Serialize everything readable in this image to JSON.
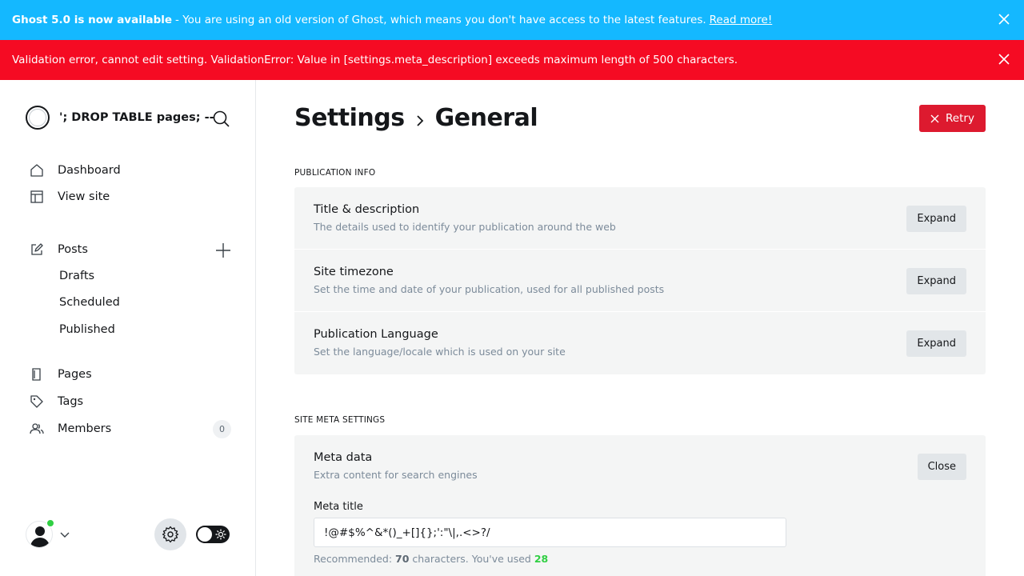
{
  "banners": {
    "upgrade": {
      "bold": "Ghost 5.0 is now available",
      "text": " - You are using an old version of Ghost, which means you don't have access to the latest features.",
      "link": "Read more!",
      "color": "#14b8ff"
    },
    "error": {
      "text": "Validation error, cannot edit setting. ValidationError: Value in [settings.meta_description] exceeds maximum length of 500 characters.",
      "color": "#f50b23"
    }
  },
  "sidebar": {
    "site_name": "'; DROP TABLE pages; --",
    "nav": {
      "dashboard": "Dashboard",
      "view_site": "View site",
      "posts": "Posts",
      "drafts": "Drafts",
      "scheduled": "Scheduled",
      "published": "Published",
      "pages": "Pages",
      "tags": "Tags",
      "members": "Members",
      "members_count": "0"
    }
  },
  "header": {
    "breadcrumb_root": "Settings",
    "breadcrumb_current": "General",
    "retry_label": "Retry"
  },
  "sections": {
    "publication_info": {
      "label": "Publication info",
      "rows": [
        {
          "title": "Title & description",
          "desc": "The details used to identify your publication around the web",
          "button": "Expand"
        },
        {
          "title": "Site timezone",
          "desc": "Set the time and date of your publication, used for all published posts",
          "button": "Expand"
        },
        {
          "title": "Publication Language",
          "desc": "Set the language/locale which is used on your site",
          "button": "Expand"
        }
      ]
    },
    "site_meta": {
      "label": "Site meta settings",
      "title": "Meta data",
      "desc": "Extra content for search engines",
      "button": "Close",
      "meta_title_label": "Meta title",
      "meta_title_value": "!@#$%^&*()_+[]{};':\"\\|,.<>?/",
      "hint_prefix": "Recommended: ",
      "hint_recommended": "70",
      "hint_middle": " characters. You've used ",
      "hint_used": "28"
    }
  }
}
